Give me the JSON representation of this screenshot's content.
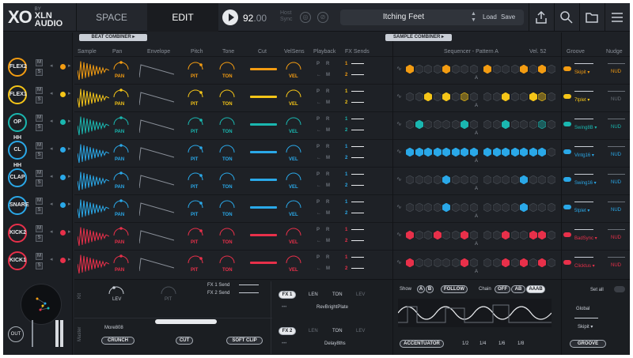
{
  "colors": {
    "orange": "#f39c12",
    "yellow": "#f5c518",
    "teal": "#1ab7b0",
    "blue": "#2aa8e8",
    "red": "#e8304a",
    "bg": "#1e2126"
  },
  "header": {
    "logo_xo": "XO",
    "logo_by": "BY",
    "logo_xln": "XLN",
    "logo_audio": "AUDIO",
    "tab_space": "SPACE",
    "tab_edit": "EDIT",
    "bpm_int": "92",
    "bpm_dec": ".00",
    "host_sync_line1": "Host",
    "host_sync_line2": "Sync",
    "preset_name": "Itching Feet",
    "load": "Load",
    "save": "Save"
  },
  "tracks": [
    {
      "name": "FLEX2",
      "color": "#f39c12",
      "groove": "Skipit",
      "nudge": "NUD",
      "nudge_active": true
    },
    {
      "name": "FLEX1",
      "color": "#f5c518",
      "groove": "7tplet",
      "nudge": "NUD",
      "nudge_active": false
    },
    {
      "name": "OP HH",
      "color": "#1ab7b0",
      "groove": "Swing8B",
      "nudge": "NUD",
      "nudge_active": true
    },
    {
      "name": "CL HH",
      "color": "#2aa8e8",
      "groove": "Vintg16",
      "nudge": "NUD",
      "nudge_active": true
    },
    {
      "name": "CLAP",
      "color": "#2aa8e8",
      "groove": "Swing16",
      "nudge": "NUD",
      "nudge_active": true
    },
    {
      "name": "SNARE",
      "color": "#2aa8e8",
      "groove": "5tplet",
      "nudge": "NUD",
      "nudge_active": true
    },
    {
      "name": "KICK2",
      "color": "#e8304a",
      "groove": "BadSync",
      "nudge": "NUD",
      "nudge_active": true
    },
    {
      "name": "KICK1",
      "color": "#e8304a",
      "groove": "Clicktus",
      "nudge": "NUD",
      "nudge_active": true
    }
  ],
  "ms": {
    "m": "M",
    "s": "S"
  },
  "combiners": {
    "beat": "BEAT COMBINER",
    "sample": "SAMPLE COMBINER"
  },
  "columns": {
    "sample": "Sample",
    "pan": "Pan",
    "envelope": "Envelope",
    "pitch": "Pitch",
    "tone": "Tone",
    "cut": "Cut",
    "velsens": "VelSens",
    "playback": "Playback",
    "fxsends": "FX Sends",
    "sequencer": "Sequencer - Pattern A",
    "vel": "Vel.",
    "vel_value": "52",
    "groove": "Groove",
    "nudge": "Nudge"
  },
  "row_labels": {
    "pan": "PAN",
    "pit": "PIT",
    "ton": "TON",
    "vel": "VEL",
    "p": "P",
    "r": "R",
    "m": "M",
    "fx1": "1",
    "fx2": "2"
  },
  "pattern_markers": [
    "A",
    "A",
    "A",
    "A",
    "A",
    "A",
    "A",
    "A"
  ],
  "sequencer": {
    "steps": [
      [
        1,
        0,
        0,
        0,
        1,
        0,
        0,
        0,
        1,
        0,
        0,
        0,
        1,
        0,
        1,
        0
      ],
      [
        0,
        0,
        1,
        0,
        1,
        0,
        2,
        0,
        0,
        0,
        1,
        0,
        0,
        1,
        2,
        0
      ],
      [
        0,
        1,
        0,
        0,
        0,
        0,
        1,
        0,
        0,
        0,
        1,
        0,
        0,
        0,
        2,
        0
      ],
      [
        1,
        1,
        1,
        1,
        1,
        1,
        1,
        1,
        1,
        1,
        1,
        1,
        1,
        1,
        1,
        0
      ],
      [
        0,
        0,
        0,
        0,
        1,
        0,
        0,
        0,
        0,
        0,
        0,
        0,
        1,
        0,
        0,
        0
      ],
      [
        0,
        0,
        0,
        0,
        1,
        0,
        0,
        0,
        0,
        0,
        0,
        0,
        1,
        0,
        0,
        0
      ],
      [
        1,
        0,
        0,
        1,
        0,
        0,
        1,
        0,
        0,
        0,
        1,
        0,
        0,
        1,
        1,
        0
      ],
      [
        1,
        0,
        0,
        0,
        0,
        0,
        1,
        0,
        0,
        0,
        1,
        0,
        1,
        0,
        1,
        0
      ]
    ]
  },
  "seq_bottom": {
    "show": "Show",
    "a": "A",
    "b": "B",
    "follow": "FOLLOW",
    "chain": "Chain",
    "off": "OFF",
    "ab": "AB",
    "aaab": "AAAB",
    "accentuator": "ACCENTUATOR",
    "div1": "1/2",
    "div2": "1/4",
    "div3": "1/6",
    "div4": "1/8"
  },
  "groove_bottom": {
    "set_all": "Set all",
    "global": "Global",
    "global_value": "Skipit",
    "groove_btn": "GROOVE"
  },
  "kit_panel": {
    "kit": "Kit",
    "master": "Master",
    "lev": "LEV",
    "pit": "PIT",
    "fx1_send": "FX 1 Send",
    "fx2_send": "FX 2 Send",
    "preset": "More808",
    "crunch": "CRUNCH",
    "cut": "CUT",
    "soft_clip": "SOFT CLIP"
  },
  "fx_panel": {
    "fx1": "FX 1",
    "fx2": "FX 2",
    "len": "LEN",
    "ton": "TON",
    "lev": "LEV",
    "fx1_preset": "RevBrightPlate",
    "fx2_preset": "Delay8ths",
    "dots": "•••"
  },
  "sidebar_bottom": {
    "out": "OUT"
  }
}
